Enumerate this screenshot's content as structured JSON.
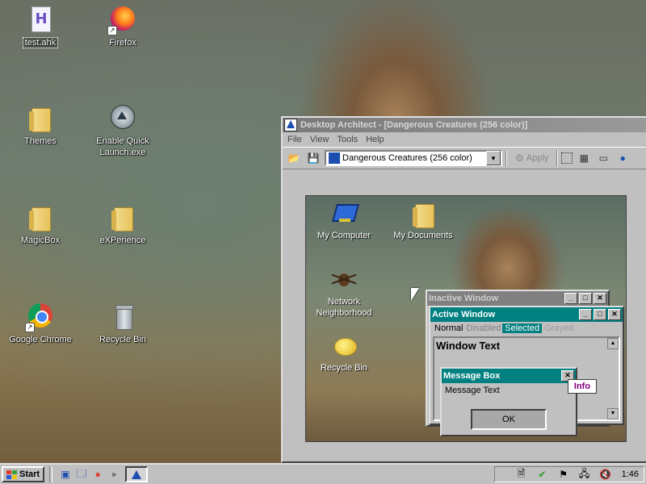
{
  "desktop": {
    "icons": [
      {
        "label": "test.ahk"
      },
      {
        "label": "Firefox"
      },
      {
        "label": "Themes"
      },
      {
        "label": "Enable Quick Launch.exe"
      },
      {
        "label": "MagicBox"
      },
      {
        "label": "eXPerience"
      },
      {
        "label": "Google Chrome"
      },
      {
        "label": "Recycle Bin"
      }
    ]
  },
  "app": {
    "title": "Desktop Architect - [Dangerous Creatures (256 color)]",
    "menu": [
      "File",
      "View",
      "Tools",
      "Help"
    ],
    "theme_select": "Dangerous Creatures (256 color)",
    "apply_label": "Apply"
  },
  "preview": {
    "icons": [
      {
        "label": "My Computer"
      },
      {
        "label": "My Documents"
      },
      {
        "label": "Network Neighborhood"
      },
      {
        "label": "Recycle Bin"
      }
    ],
    "inactive_window_title": "Inactive Window",
    "active_window_title": "Active Window",
    "menu_normal": "Normal",
    "menu_disabled": "Disabled",
    "menu_selected": "Selected",
    "menu_grayed": "Grayed",
    "window_text": "Window Text",
    "message_box_title": "Message Box",
    "message_text": "Message Text",
    "ok_label": "OK",
    "tooltip": "Info"
  },
  "taskbar": {
    "start_label": "Start",
    "clock": "1:46"
  },
  "colors": {
    "active_title": "#008080",
    "inactive_title": "#808080",
    "selected_menu": "#008080"
  }
}
